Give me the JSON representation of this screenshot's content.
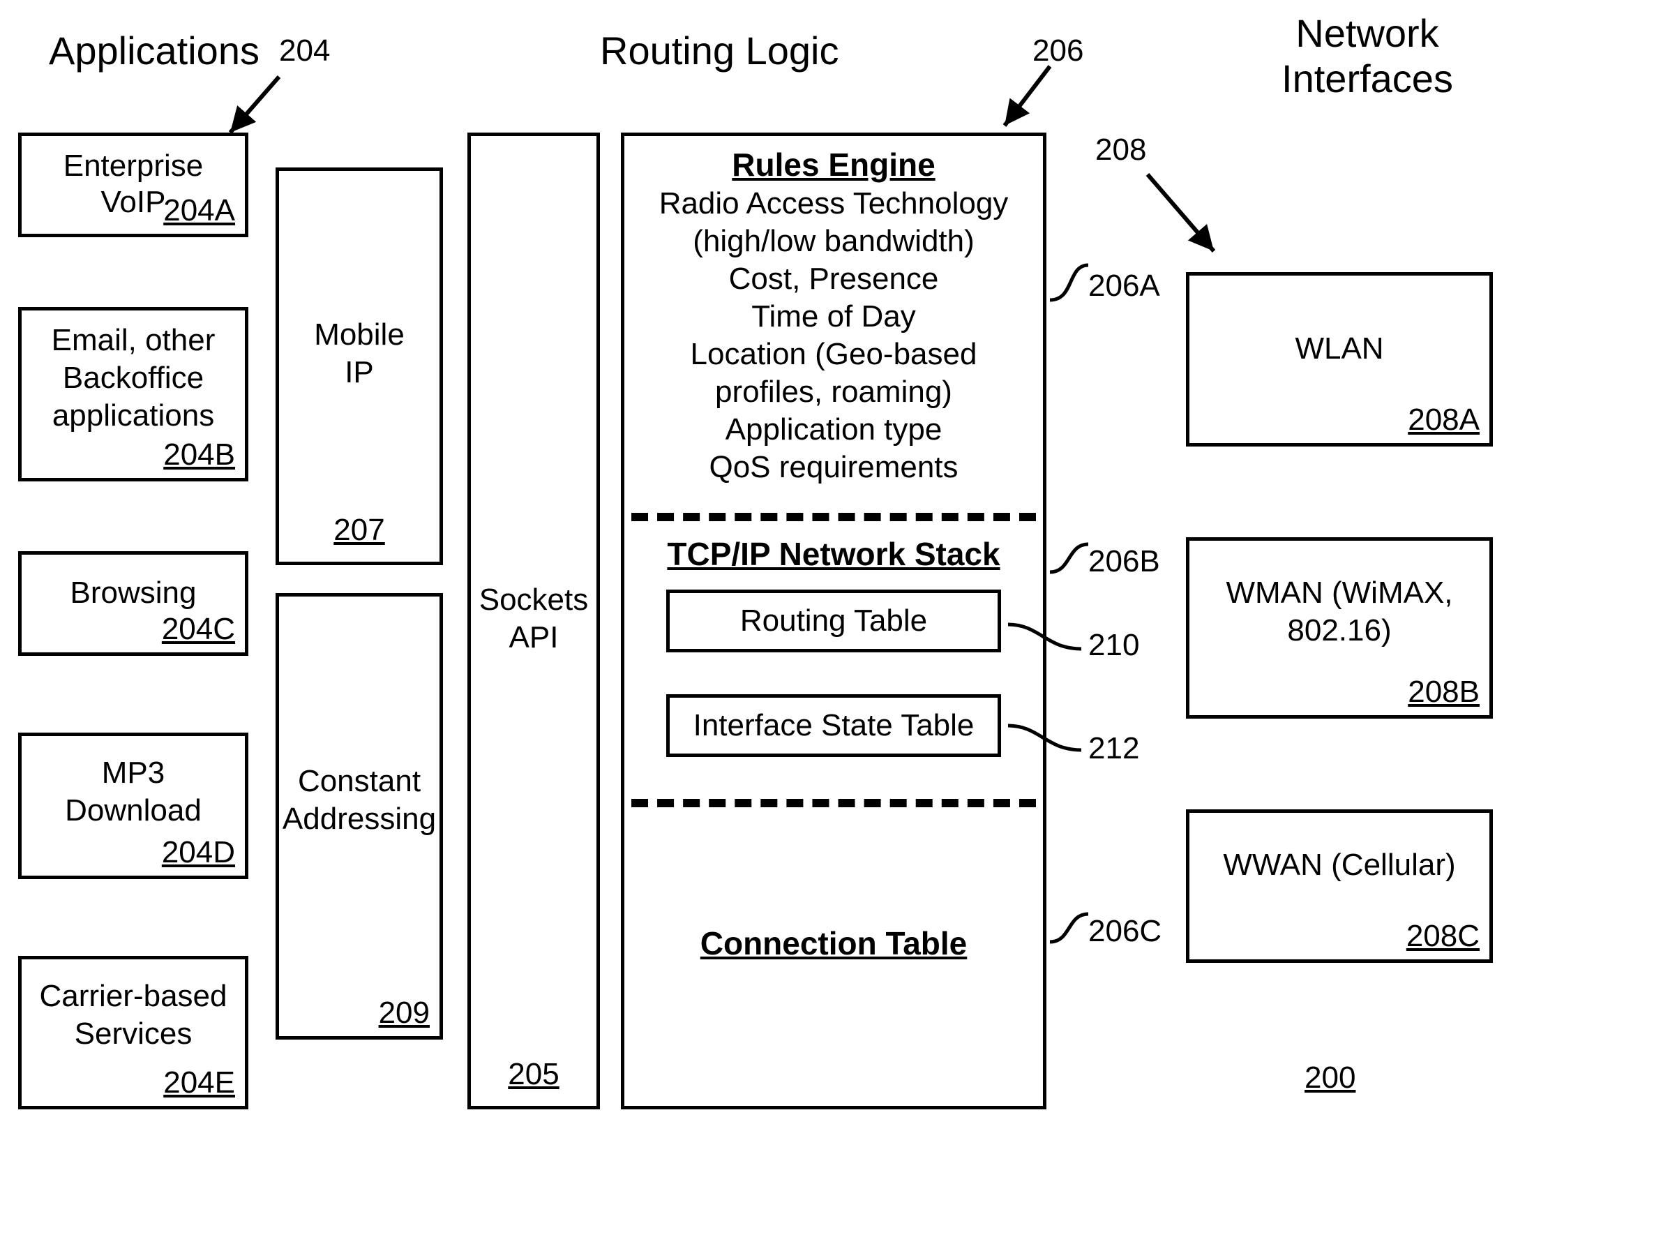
{
  "headings": {
    "applications": "Applications",
    "routing_logic": "Routing Logic",
    "network_interfaces_l1": "Network",
    "network_interfaces_l2": "Interfaces"
  },
  "refs": {
    "applications": "204",
    "routing_logic": "206",
    "network_interfaces": "208",
    "figure": "200"
  },
  "apps": {
    "a": {
      "l1": "Enterprise",
      "l2": "VoIP",
      "ref": "204A"
    },
    "b": {
      "l1": "Email, other",
      "l2": "Backoffice",
      "l3": "applications",
      "ref": "204B"
    },
    "c": {
      "l1": "Browsing",
      "ref": "204C"
    },
    "d": {
      "l1": "MP3",
      "l2": "Download",
      "ref": "204D"
    },
    "e": {
      "l1": "Carrier-based",
      "l2": "Services",
      "ref": "204E"
    }
  },
  "mobile_ip": {
    "l1": "Mobile",
    "l2": "IP",
    "ref": "207"
  },
  "constant_addressing": {
    "l1": "Constant",
    "l2": "Addressing",
    "ref": "209"
  },
  "sockets_api": {
    "l1": "Sockets",
    "l2": "API",
    "ref": "205"
  },
  "routing": {
    "rules_engine": {
      "title": "Rules Engine",
      "l1": "Radio Access Technology",
      "l2": "(high/low bandwidth)",
      "l3": "Cost, Presence",
      "l4": "Time of Day",
      "l5": "Location (Geo-based",
      "l6": "profiles, roaming)",
      "l7": "Application type",
      "l8": "QoS requirements",
      "ref": "206A"
    },
    "tcpip": {
      "title": "TCP/IP Network Stack",
      "routing_table": "Routing Table",
      "routing_table_ref": "210",
      "interface_state_table": "Interface State Table",
      "interface_state_table_ref": "212",
      "ref": "206B"
    },
    "connection_table": {
      "title": "Connection Table",
      "ref": "206C"
    }
  },
  "interfaces": {
    "a": {
      "l1": "WLAN",
      "ref": "208A"
    },
    "b": {
      "l1": "WMAN (WiMAX,",
      "l2": "802.16)",
      "ref": "208B"
    },
    "c": {
      "l1": "WWAN (Cellular)",
      "ref": "208C"
    }
  }
}
